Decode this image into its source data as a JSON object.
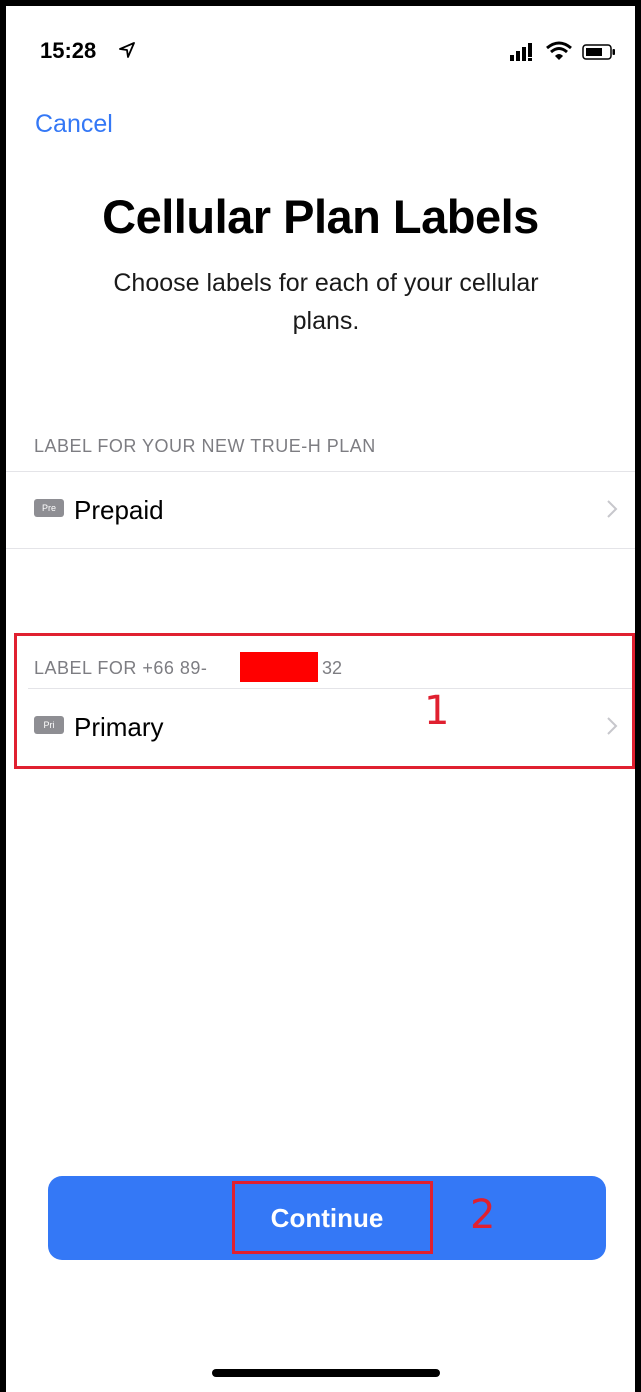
{
  "status_bar": {
    "time": "15:28",
    "icons": [
      "location-arrow-icon",
      "cellular-signal-icon",
      "wifi-icon",
      "battery-icon"
    ]
  },
  "nav": {
    "cancel_label": "Cancel"
  },
  "header": {
    "title": "Cellular Plan Labels",
    "subtitle": "Choose labels for each of your cellular plans."
  },
  "sections": [
    {
      "header": "LABEL FOR YOUR NEW TRUE-H PLAN",
      "badge": "Pre",
      "value": "Prepaid"
    },
    {
      "header": "LABEL FOR +66 89-",
      "header_suffix": "32",
      "badge": "Pri",
      "value": "Primary"
    }
  ],
  "annotations": [
    "1",
    "2"
  ],
  "footer": {
    "continue_label": "Continue"
  },
  "colors": {
    "accent": "#3478f6",
    "annotation": "#e02030",
    "redaction": "#ff0000"
  }
}
